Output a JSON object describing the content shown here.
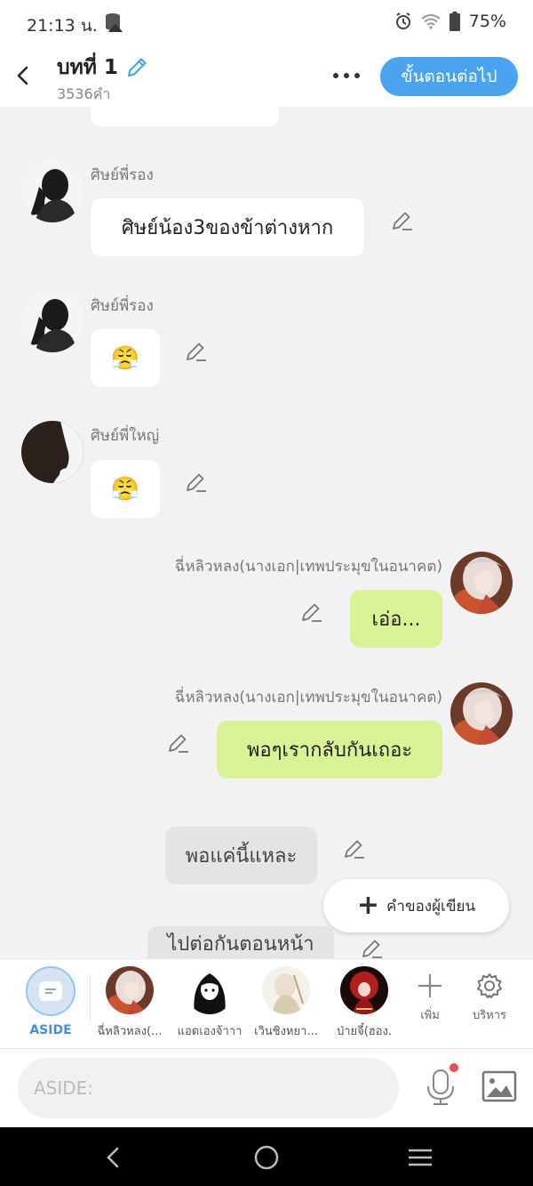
{
  "status_bar": {
    "time": "21:13 น.",
    "battery": "75%"
  },
  "header": {
    "title": "บทที่ 1",
    "word_count": "3536คำ",
    "next_label": "ขั้นตอนต่อไป"
  },
  "messages": [
    {
      "sender": "ศิษย์พี่รอง",
      "text": "ศิษย์น้อง3ของข้าต่างหาก",
      "side": "left"
    },
    {
      "sender": "ศิษย์พี่รอง",
      "text": "😤",
      "side": "left"
    },
    {
      "sender": "ศิษย์พี่ใหญ่",
      "text": "😤",
      "side": "left"
    },
    {
      "sender": "ฉี่หลิวหลง(นางเอก|เทพประมุขในอนาคต)",
      "text": "เอ่อ...",
      "side": "right"
    },
    {
      "sender": "ฉี่หลิวหลง(นางเอก|เทพประมุขในอนาคต)",
      "text": "พอๆเรากลับกันเถอะ",
      "side": "right"
    },
    {
      "text": "พอแค่นี้แหละ",
      "side": "aside"
    },
    {
      "text": "ไปต่อกันตอนหน้า",
      "side": "aside"
    }
  ],
  "writer_button": {
    "label": "คำของผู้เขียน"
  },
  "characters": {
    "aside_label": "ASIDE",
    "items": [
      {
        "name": "ฉี่หลิวหลง(..."
      },
      {
        "name": "แอดเองจ้าาา"
      },
      {
        "name": "เวินชิงหยา..."
      },
      {
        "name": "ป่ายจี๋(ฮอง."
      }
    ],
    "add_label": "เพิ่ม",
    "manage_label": "บริหาร"
  },
  "input": {
    "placeholder": "ASIDE:"
  },
  "colors": {
    "accent": "#4aa3ef",
    "right_bubble": "#d9f296",
    "aside_bubble": "#e4e4e4"
  }
}
